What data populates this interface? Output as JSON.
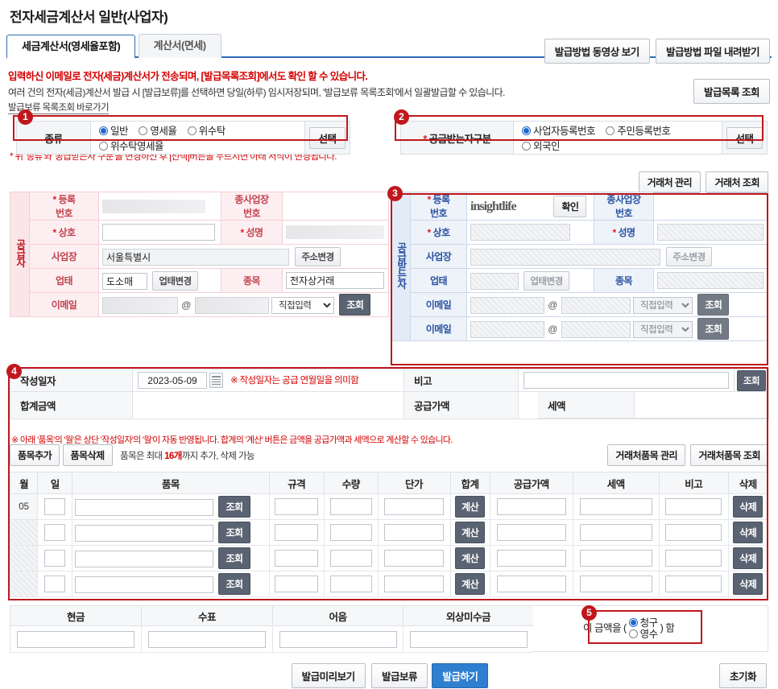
{
  "page": {
    "title": "전자세금계산서 일반(사업자)"
  },
  "tabs": [
    {
      "label": "세금계산서(영세율포함)",
      "active": true
    },
    {
      "label": "계산서(면세)",
      "active": false
    }
  ],
  "header_buttons": {
    "video": "발급방법 동영상 보기",
    "file": "발급방법 파일 내려받기"
  },
  "notice": {
    "line1": "입력하신 이메일로 전자(세금)계산서가 전송되며, [발급목록조회]에서도 확인 할 수 있습니다.",
    "line2": "여러 건의 전자(세금)계산서 발급 시 [발급보류]를 선택하면 당일(하루) 임시저장되며, '발급보류 목록조회'에서 일괄발급할 수 있습니다.",
    "link": "발급보류 목록조회 바로가기",
    "list_button": "발급목록 조회"
  },
  "badges": [
    "1",
    "2",
    "3",
    "4",
    "5"
  ],
  "type_row": {
    "label": "종류",
    "options": [
      "일반",
      "영세율",
      "위수탁",
      "위수탁영세율"
    ],
    "selected": "일반",
    "select_button": "선택"
  },
  "receiver_type_row": {
    "label": "공급받는자구분",
    "required_mark": "*",
    "options": [
      "사업자등록번호",
      "주민등록번호",
      "외국인"
    ],
    "selected": "사업자등록번호",
    "select_button": "선택"
  },
  "type_note": "* 위 '종류'와 '공급받는자 구분'을 변경하신 후 [선택]버튼을 누르시면 아래 서식이 변경됩니다.",
  "vendor_buttons": {
    "manage": "거래처 관리",
    "lookup": "거래처 조회"
  },
  "supplier": {
    "side_label": "공급자",
    "reg_no_label": "등록\n번호",
    "reg_no_label_l1": "등록",
    "reg_no_label_l2": "번호",
    "sub_biz_label_l1": "종사업장",
    "sub_biz_label_l2": "번호",
    "company_label": "상호",
    "name_label": "성명",
    "address_label": "사업장",
    "address_value": "서울특별시",
    "address_button": "주소변경",
    "biz_type_label": "업태",
    "biz_type_value": "도소매",
    "biz_type_button": "업태변경",
    "item_label": "종목",
    "item_value": "전자상거래",
    "email_label": "이메일",
    "email_at": "@",
    "email_select": "직접입력",
    "email_button": "조회",
    "company_value": "",
    "name_value": "",
    "reg_no_value": "",
    "sub_biz_value": ""
  },
  "receiver": {
    "side_label": "공급받는자",
    "reg_no_label_l1": "등록",
    "reg_no_label_l2": "번호",
    "reg_no_watermark": "insightlife",
    "confirm_button": "확인",
    "sub_biz_label_l1": "종사업장",
    "sub_biz_label_l2": "번호",
    "company_label": "상호",
    "name_label": "성명",
    "address_label": "사업장",
    "address_button": "주소변경",
    "biz_type_label": "업태",
    "biz_type_button": "업태변경",
    "item_label": "종목",
    "email_label": "이메일",
    "email_label2": "이메일",
    "email_at": "@",
    "email_select": "직접입력",
    "email_button": "조회"
  },
  "date_row": {
    "label": "작성일자",
    "value": "2023-05-09",
    "note": "※ 작성일자는 공급 연월일을 의미함",
    "remark_label": "비고",
    "remark_value": "",
    "remark_button": "조회"
  },
  "amount_row": {
    "total_label": "합계금액",
    "total_value": "",
    "supply_label": "공급가액",
    "supply_value": "",
    "tax_label": "세액",
    "tax_value": ""
  },
  "item_guide": "※ 아래 '품목'의 '월'은 상단 '작성일자'의 '월'이 자동 반영됩니다. 합계의 '계산' 버튼은 금액을 공급가액과 세액으로 계산할 수 있습니다.",
  "item_bar": {
    "add": "품목추가",
    "delete": "품목삭제",
    "note_pre": "품목은 최대 ",
    "note_count": "16개",
    "note_post": "까지 추가, 삭제 가능",
    "manage": "거래처품목 관리",
    "lookup": "거래처품목 조회"
  },
  "items_table": {
    "headers": [
      "월",
      "일",
      "품목",
      "규격",
      "수량",
      "단가",
      "합계",
      "공급가액",
      "세액",
      "비고",
      "삭제"
    ],
    "lookup_button": "조회",
    "calc_button": "계산",
    "delete_button": "삭제",
    "rows": [
      {
        "month": "05",
        "day": "",
        "name": "",
        "spec": "",
        "qty": "",
        "price": "",
        "total": "",
        "supply": "",
        "tax": "",
        "remark": ""
      },
      {
        "month": "",
        "day": "",
        "name": "",
        "spec": "",
        "qty": "",
        "price": "",
        "total": "",
        "supply": "",
        "tax": "",
        "remark": ""
      },
      {
        "month": "",
        "day": "",
        "name": "",
        "spec": "",
        "qty": "",
        "price": "",
        "total": "",
        "supply": "",
        "tax": "",
        "remark": ""
      },
      {
        "month": "",
        "day": "",
        "name": "",
        "spec": "",
        "qty": "",
        "price": "",
        "total": "",
        "supply": "",
        "tax": "",
        "remark": ""
      }
    ]
  },
  "payment": {
    "headers": [
      "현금",
      "수표",
      "어음",
      "외상미수금"
    ],
    "values": [
      "",
      "",
      "",
      ""
    ],
    "claim_prefix": "이 금액을 (",
    "claim_options": [
      "청구",
      "영수"
    ],
    "claim_selected": "청구",
    "claim_suffix": ") 함"
  },
  "footer": {
    "preview": "발급미리보기",
    "hold": "발급보류",
    "issue": "발급하기",
    "reset": "초기화"
  },
  "colors": {
    "accent_blue": "#2f7fd0",
    "badge_red": "#c0171d",
    "notice_red": "#d40000",
    "supplier_pink": "#fdeff1",
    "receiver_blue": "#eef3fa"
  }
}
